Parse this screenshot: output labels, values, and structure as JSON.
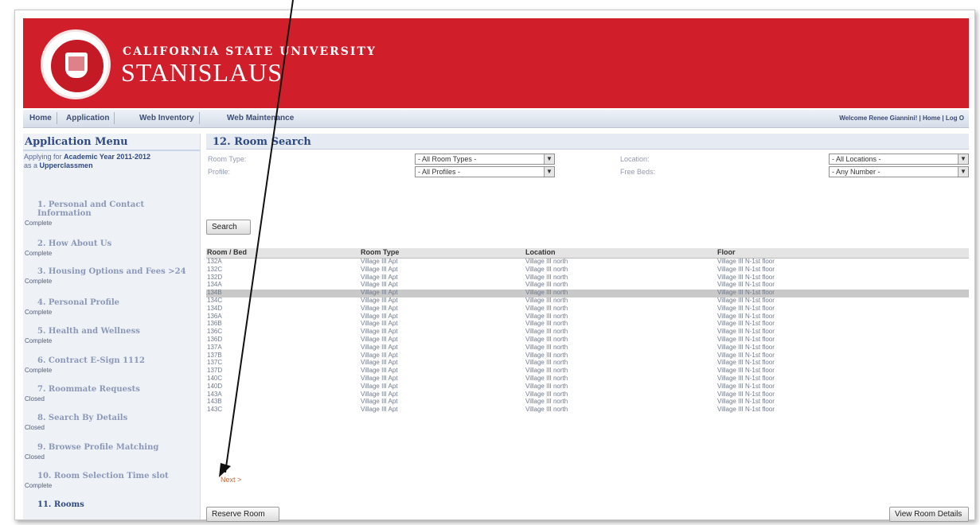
{
  "banner": {
    "line1": "CALIFORNIA STATE UNIVERSITY",
    "line2": "STANISLAUS",
    "color": "#d01f2b"
  },
  "nav": {
    "tabs": [
      "Home",
      "Application",
      "Web Inventory",
      "Web Maintenance"
    ],
    "welcome": "Welcome Renee Giannini! | Home | Log O"
  },
  "sidebar": {
    "title": "Application Menu",
    "applying_prefix": "Applying for",
    "applying_year": "Academic Year 2011-2012",
    "as_prefix": "as a",
    "as_value": "Upperclassmen",
    "steps": [
      {
        "label": "1. Personal and Contact Information",
        "status": "Complete"
      },
      {
        "label": "2. How About Us",
        "status": "Complete"
      },
      {
        "label": "3. Housing Options and Fees >24",
        "status": "Complete"
      },
      {
        "label": "4. Personal Profile",
        "status": "Complete"
      },
      {
        "label": "5. Health and Wellness",
        "status": "Complete"
      },
      {
        "label": "6. Contract E-Sign 1112",
        "status": "Complete"
      },
      {
        "label": "7. Roommate Requests",
        "status": "Closed"
      },
      {
        "label": "8. Search By Details",
        "status": "Closed"
      },
      {
        "label": "9. Browse Profile Matching",
        "status": "Closed"
      },
      {
        "label": "10. Room Selection Time slot",
        "status": "Complete"
      },
      {
        "label": "11. Rooms",
        "status": ""
      }
    ]
  },
  "main": {
    "title": "12. Room Search",
    "filters": {
      "room_type_label": "Room Type:",
      "room_type_value": "- All Room Types -",
      "profile_label": "Profile:",
      "profile_value": "- All Profiles -",
      "location_label": "Location:",
      "location_value": "- All Locations -",
      "free_beds_label": "Free Beds:",
      "free_beds_value": "- Any Number -"
    },
    "search_button": "Search",
    "columns": [
      "Room / Bed",
      "Room Type",
      "Location",
      "Floor"
    ],
    "rows": [
      [
        "132A",
        "Village III Apt",
        "Village III north",
        "Village III N-1st floor"
      ],
      [
        "132C",
        "Village III Apt",
        "Village III north",
        "Village III N-1st floor"
      ],
      [
        "132D",
        "Village III Apt",
        "Village III north",
        "Village III N-1st floor"
      ],
      [
        "134A",
        "Village III Apt",
        "Village III north",
        "Village III N-1st floor"
      ],
      [
        "134B",
        "Village III Apt",
        "Village III north",
        "Village III N-1st floor"
      ],
      [
        "134C",
        "Village III Apt",
        "Village III north",
        "Village III N-1st floor"
      ],
      [
        "134D",
        "Village III Apt",
        "Village III north",
        "Village III N-1st floor"
      ],
      [
        "136A",
        "Village III Apt",
        "Village III north",
        "Village III N-1st floor"
      ],
      [
        "136B",
        "Village III Apt",
        "Village III north",
        "Village III N-1st floor"
      ],
      [
        "136C",
        "Village III Apt",
        "Village III north",
        "Village III N-1st floor"
      ],
      [
        "136D",
        "Village III Apt",
        "Village III north",
        "Village III N-1st floor"
      ],
      [
        "137A",
        "Village III Apt",
        "Village III north",
        "Village III N-1st floor"
      ],
      [
        "137B",
        "Village III Apt",
        "Village III north",
        "Village III N-1st floor"
      ],
      [
        "137C",
        "Village III Apt",
        "Village III north",
        "Village III N-1st floor"
      ],
      [
        "137D",
        "Village III Apt",
        "Village III north",
        "Village III N-1st floor"
      ],
      [
        "140C",
        "Village III Apt",
        "Village III north",
        "Village III N-1st floor"
      ],
      [
        "140D",
        "Village III Apt",
        "Village III north",
        "Village III N-1st floor"
      ],
      [
        "143A",
        "Village III Apt",
        "Village III north",
        "Village III N-1st floor"
      ],
      [
        "143B",
        "Village III Apt",
        "Village III north",
        "Village III N-1st floor"
      ],
      [
        "143C",
        "Village III Apt",
        "Village III north",
        "Village III N-1st floor"
      ]
    ],
    "selected_row_index": 4,
    "next_link": "Next >",
    "reserve_button": "Reserve Room",
    "details_button": "View Room Details"
  }
}
